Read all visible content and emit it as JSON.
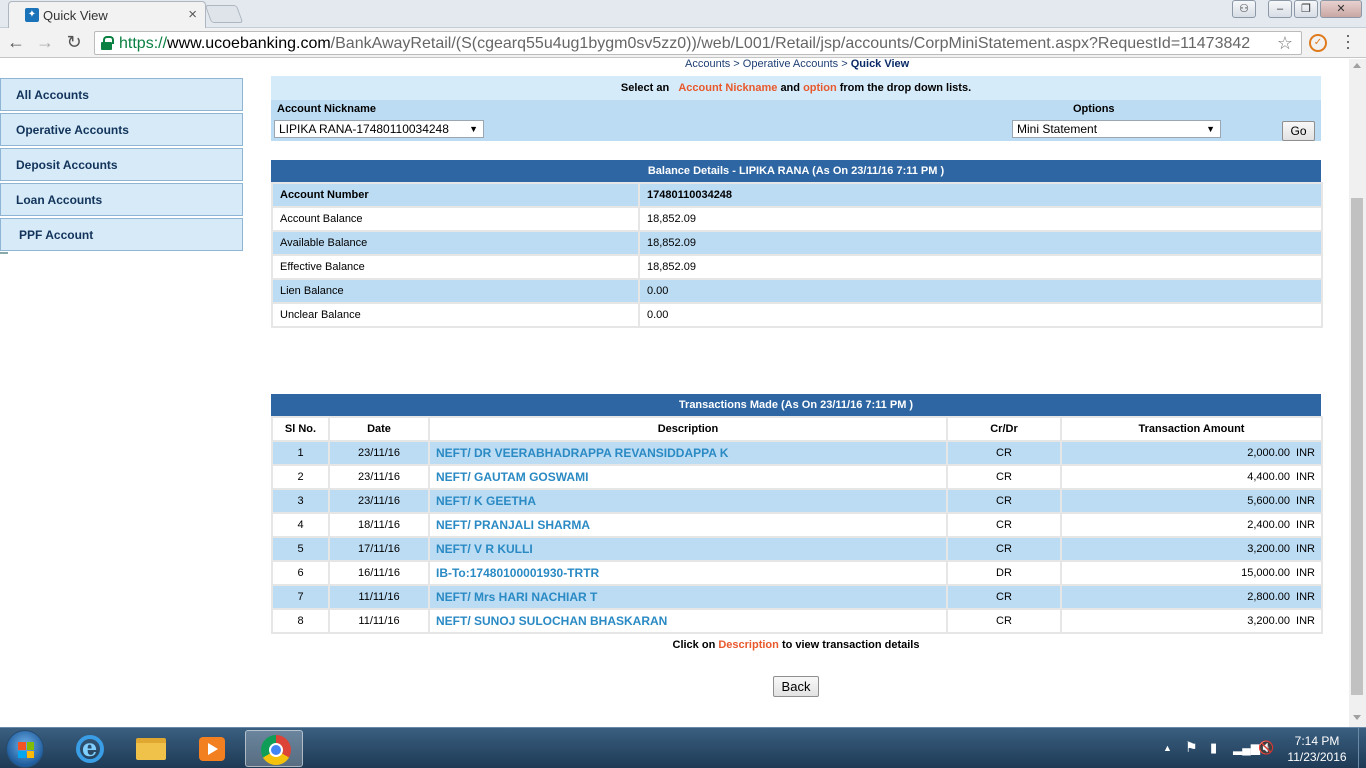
{
  "browser": {
    "tab_title": "Quick View",
    "url_scheme": "https://",
    "url_host": "www.ucoebanking.com",
    "url_path": "/BankAwayRetail/(S(cgearq55u4ug1bygm0sv5zz0))/web/L001/Retail/jsp/accounts/CorpMiniStatement.aspx?RequestId=11473842"
  },
  "sidebar": {
    "items": [
      {
        "label": "All Accounts"
      },
      {
        "label": "Operative Accounts"
      },
      {
        "label": "Deposit Accounts"
      },
      {
        "label": "Loan Accounts"
      },
      {
        "label": "PPF Account"
      }
    ]
  },
  "breadcrumb": {
    "items": [
      "Accounts",
      "Operative Accounts"
    ],
    "separator": " > ",
    "current": "Quick View"
  },
  "selection": {
    "hint_pre": "Select an",
    "hint_hl1": "Account Nickname",
    "hint_mid": "and",
    "hint_hl2": "option",
    "hint_post": "from the drop down lists.",
    "nickname_label": "Account Nickname",
    "nickname_value": "LIPIKA RANA-17480110034248",
    "options_label": "Options",
    "options_value": "Mini Statement",
    "go_label": "Go"
  },
  "balance": {
    "title": "Balance Details - LIPIKA RANA (As On 23/11/16 7:11 PM )",
    "rows": [
      {
        "label": "Account Number",
        "value": "17480110034248"
      },
      {
        "label": "Account Balance",
        "value": "18,852.09"
      },
      {
        "label": "Available Balance",
        "value": "18,852.09"
      },
      {
        "label": "Effective Balance",
        "value": "18,852.09"
      },
      {
        "label": "Lien Balance",
        "value": "0.00"
      },
      {
        "label": "Unclear Balance",
        "value": "0.00"
      }
    ]
  },
  "transactions": {
    "title": "Transactions Made (As On 23/11/16 7:11 PM )",
    "headers": [
      "Sl No.",
      "Date",
      "Description",
      "Cr/Dr",
      "Transaction Amount"
    ],
    "currency": "INR",
    "rows": [
      {
        "sl": "1",
        "date": "23/11/16",
        "desc": "NEFT/ DR VEERABHADRAPPA REVANSIDDAPPA K",
        "crdr": "CR",
        "amount": "2,000.00"
      },
      {
        "sl": "2",
        "date": "23/11/16",
        "desc": "NEFT/ GAUTAM GOSWAMI",
        "crdr": "CR",
        "amount": "4,400.00"
      },
      {
        "sl": "3",
        "date": "23/11/16",
        "desc": "NEFT/ K GEETHA",
        "crdr": "CR",
        "amount": "5,600.00"
      },
      {
        "sl": "4",
        "date": "18/11/16",
        "desc": "NEFT/ PRANJALI SHARMA",
        "crdr": "CR",
        "amount": "2,400.00"
      },
      {
        "sl": "5",
        "date": "17/11/16",
        "desc": "NEFT/ V R KULLI",
        "crdr": "CR",
        "amount": "3,200.00"
      },
      {
        "sl": "6",
        "date": "16/11/16",
        "desc": "IB-To:17480100001930-TRTR",
        "crdr": "DR",
        "amount": "15,000.00"
      },
      {
        "sl": "7",
        "date": "11/11/16",
        "desc": "NEFT/ Mrs HARI NACHIAR T",
        "crdr": "CR",
        "amount": "2,800.00"
      },
      {
        "sl": "8",
        "date": "11/11/16",
        "desc": "NEFT/ SUNOJ SULOCHAN BHASKARAN",
        "crdr": "CR",
        "amount": "3,200.00"
      }
    ]
  },
  "footer_hint": {
    "pre": "Click on",
    "hl": "Description",
    "post": "to view transaction details"
  },
  "back_label": "Back",
  "taskbar": {
    "time": "7:14 PM",
    "date": "11/23/2016"
  },
  "colors": {
    "header_blue": "#2e66a3",
    "row_blue": "#bcdcf3",
    "highlight_orange": "#e8592c",
    "link_blue": "#2a8ac4"
  }
}
